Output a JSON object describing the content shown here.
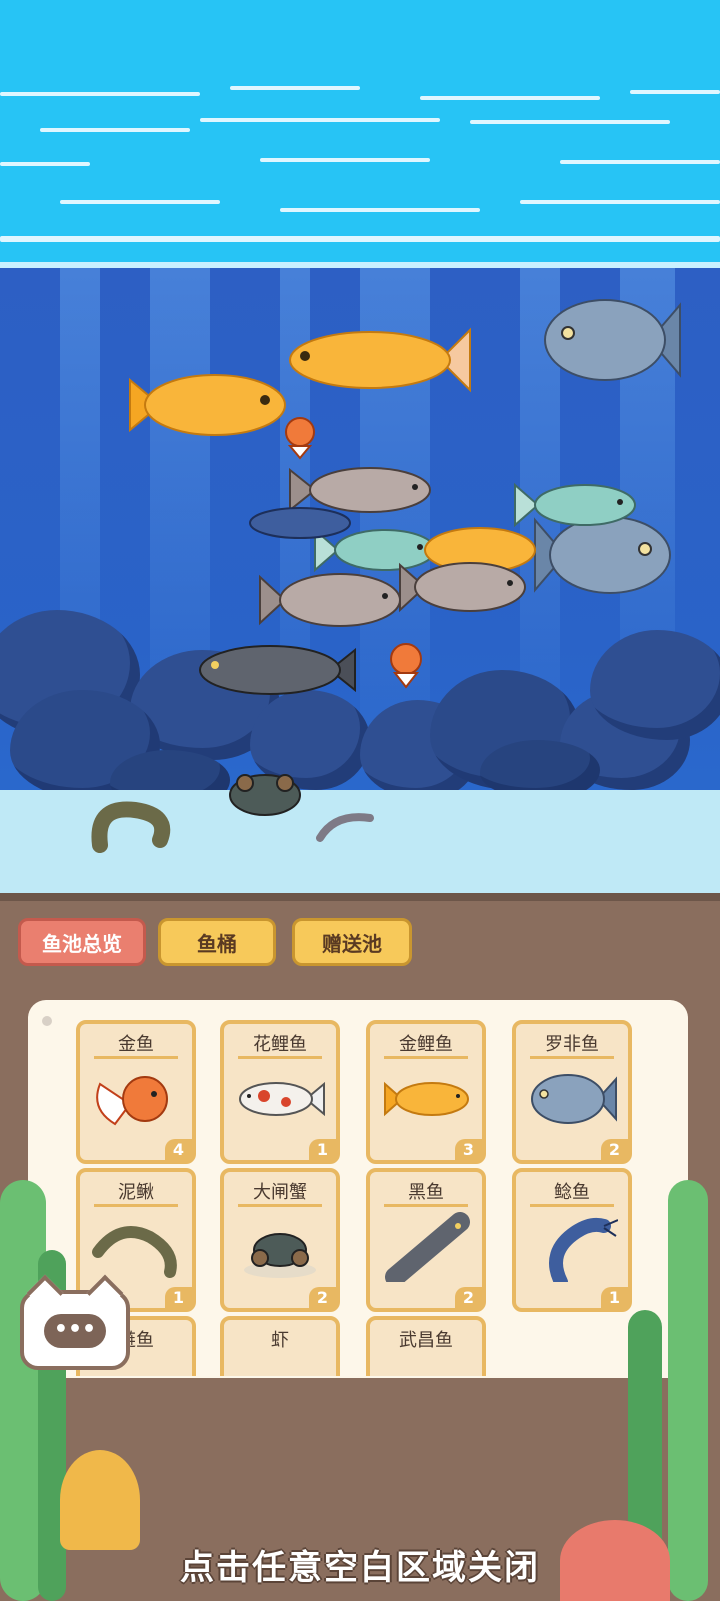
{
  "tabs": [
    {
      "label": "鱼池总览",
      "active": true
    },
    {
      "label": "鱼桶",
      "active": false
    },
    {
      "label": "赠送池",
      "active": false
    }
  ],
  "cards": [
    {
      "name": "金鱼",
      "count": "4",
      "icon": "goldfish-icon"
    },
    {
      "name": "花鲤鱼",
      "count": "1",
      "icon": "koi-icon"
    },
    {
      "name": "金鲤鱼",
      "count": "3",
      "icon": "golden-carp-icon"
    },
    {
      "name": "罗非鱼",
      "count": "2",
      "icon": "tilapia-icon"
    },
    {
      "name": "泥鳅",
      "count": "1",
      "icon": "loach-icon"
    },
    {
      "name": "大闸蟹",
      "count": "2",
      "icon": "crab-icon"
    },
    {
      "name": "黑鱼",
      "count": "2",
      "icon": "snakehead-icon"
    },
    {
      "name": "鲶鱼",
      "count": "1",
      "icon": "catfish-icon"
    },
    {
      "name": "鲢鱼",
      "count": "",
      "icon": "silver-carp-icon"
    },
    {
      "name": "虾",
      "count": "",
      "icon": "shrimp-icon"
    },
    {
      "name": "武昌鱼",
      "count": "",
      "icon": "bream-icon"
    }
  ],
  "close_hint": "点击任意空白区域关闭",
  "chat_bubble": "•••",
  "colors": {
    "sky": "#27c4f5",
    "water": "#2a63c8",
    "tab_active": "#ea7f6f",
    "tab_inactive": "#f7c95a",
    "card_border": "#e8b862"
  }
}
